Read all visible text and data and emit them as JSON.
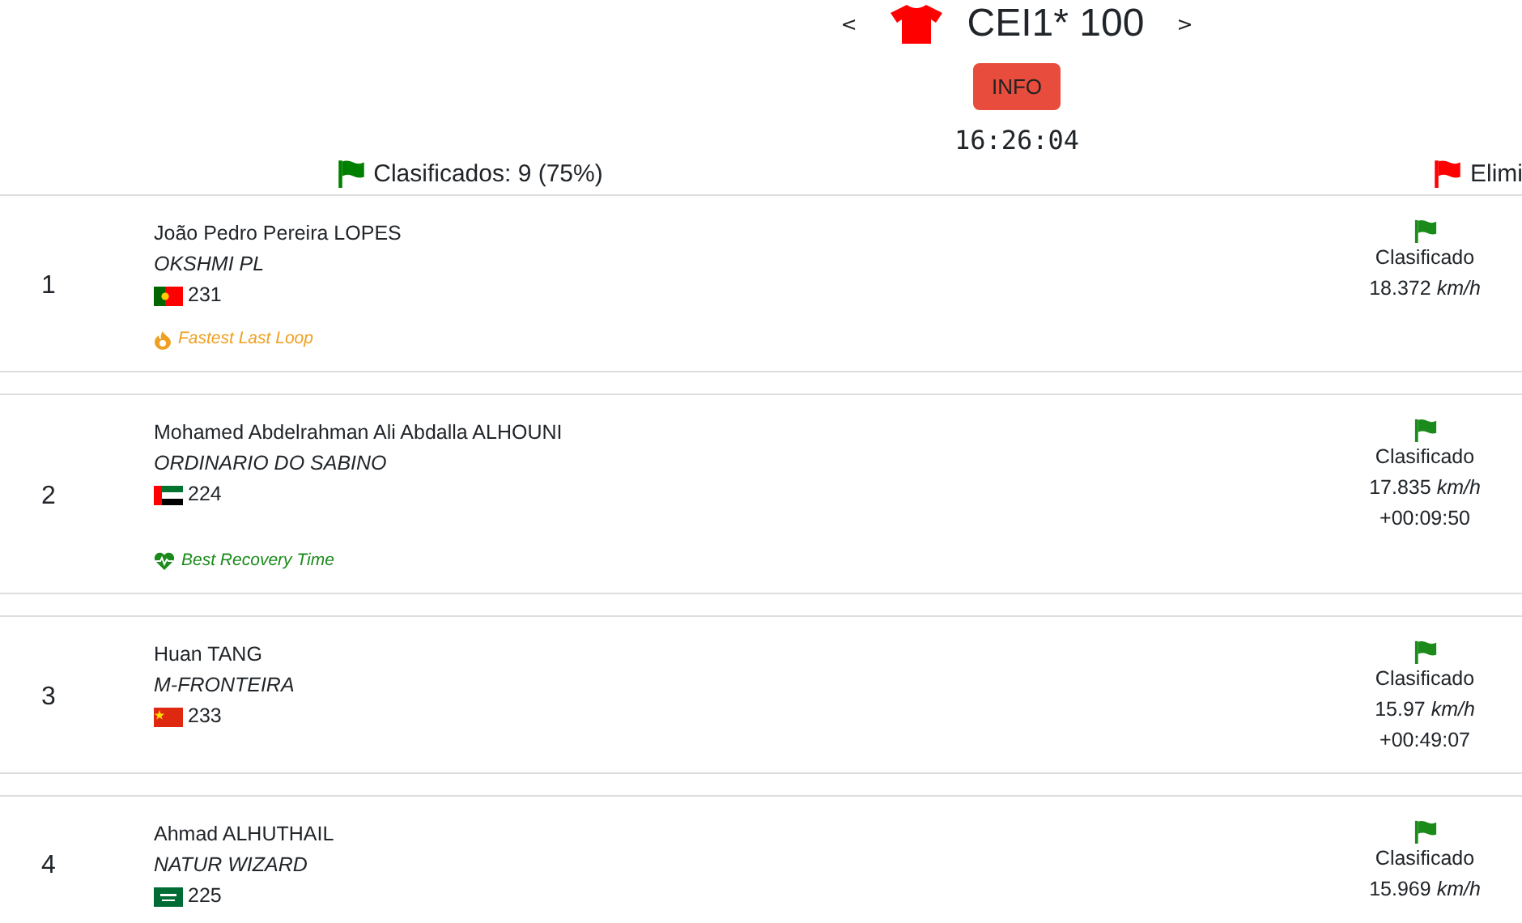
{
  "header": {
    "prev": "<",
    "title": "CEI1* 100",
    "next": ">",
    "info_button": "INFO",
    "clock": "16:26:04"
  },
  "stats": [
    {
      "label": "Clasificados: 9 (75%)",
      "color": "#008000"
    },
    {
      "label": "Elimi",
      "color": "#ff0000"
    }
  ],
  "riders": [
    {
      "rank": "1",
      "name": "João Pedro Pereira LOPES",
      "horse": "OKSHMI PL",
      "flag": {
        "kind": "pt"
      },
      "number": "231",
      "badge": {
        "kind": "fastest",
        "label": "Fastest Last Loop"
      },
      "status": "Clasificado",
      "speed": "18.372",
      "unit": "km/h"
    },
    {
      "rank": "2",
      "name": "Mohamed Abdelrahman Ali Abdalla ALHOUNI",
      "horse": "ORDINARIO DO SABINO",
      "flag": {
        "kind": "ae"
      },
      "number": "224",
      "badge": {
        "kind": "recovery",
        "label": "Best Recovery Time"
      },
      "status": "Clasificado",
      "speed": "17.835",
      "unit": "km/h",
      "gap": "+00:09:50"
    },
    {
      "rank": "3",
      "name": "Huan TANG",
      "horse": "M-FRONTEIRA",
      "flag": {
        "kind": "cn"
      },
      "number": "233",
      "status": "Clasificado",
      "speed": "15.97",
      "unit": "km/h",
      "gap": "+00:49:07"
    },
    {
      "rank": "4",
      "name": "Ahmad ALHUTHAIL",
      "horse": "NATUR WIZARD",
      "flag": {
        "kind": "sa"
      },
      "number": "225",
      "status": "Clasificado",
      "speed": "15.969",
      "unit": "km/h"
    }
  ]
}
